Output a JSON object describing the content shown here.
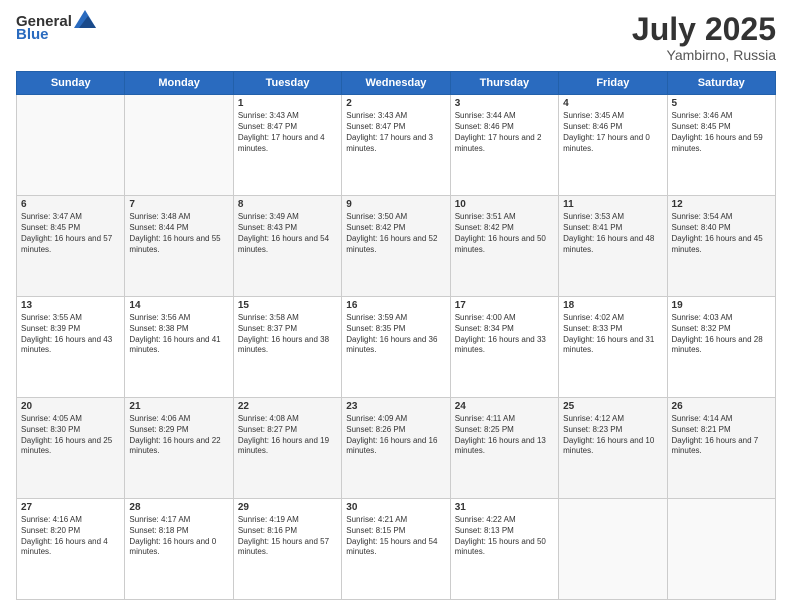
{
  "logo": {
    "text_general": "General",
    "text_blue": "Blue"
  },
  "title": {
    "month_year": "July 2025",
    "location": "Yambirno, Russia"
  },
  "weekdays": [
    "Sunday",
    "Monday",
    "Tuesday",
    "Wednesday",
    "Thursday",
    "Friday",
    "Saturday"
  ],
  "weeks": [
    [
      {
        "day": "",
        "sunrise": "",
        "sunset": "",
        "daylight": ""
      },
      {
        "day": "",
        "sunrise": "",
        "sunset": "",
        "daylight": ""
      },
      {
        "day": "1",
        "sunrise": "Sunrise: 3:43 AM",
        "sunset": "Sunset: 8:47 PM",
        "daylight": "Daylight: 17 hours and 4 minutes."
      },
      {
        "day": "2",
        "sunrise": "Sunrise: 3:43 AM",
        "sunset": "Sunset: 8:47 PM",
        "daylight": "Daylight: 17 hours and 3 minutes."
      },
      {
        "day": "3",
        "sunrise": "Sunrise: 3:44 AM",
        "sunset": "Sunset: 8:46 PM",
        "daylight": "Daylight: 17 hours and 2 minutes."
      },
      {
        "day": "4",
        "sunrise": "Sunrise: 3:45 AM",
        "sunset": "Sunset: 8:46 PM",
        "daylight": "Daylight: 17 hours and 0 minutes."
      },
      {
        "day": "5",
        "sunrise": "Sunrise: 3:46 AM",
        "sunset": "Sunset: 8:45 PM",
        "daylight": "Daylight: 16 hours and 59 minutes."
      }
    ],
    [
      {
        "day": "6",
        "sunrise": "Sunrise: 3:47 AM",
        "sunset": "Sunset: 8:45 PM",
        "daylight": "Daylight: 16 hours and 57 minutes."
      },
      {
        "day": "7",
        "sunrise": "Sunrise: 3:48 AM",
        "sunset": "Sunset: 8:44 PM",
        "daylight": "Daylight: 16 hours and 55 minutes."
      },
      {
        "day": "8",
        "sunrise": "Sunrise: 3:49 AM",
        "sunset": "Sunset: 8:43 PM",
        "daylight": "Daylight: 16 hours and 54 minutes."
      },
      {
        "day": "9",
        "sunrise": "Sunrise: 3:50 AM",
        "sunset": "Sunset: 8:42 PM",
        "daylight": "Daylight: 16 hours and 52 minutes."
      },
      {
        "day": "10",
        "sunrise": "Sunrise: 3:51 AM",
        "sunset": "Sunset: 8:42 PM",
        "daylight": "Daylight: 16 hours and 50 minutes."
      },
      {
        "day": "11",
        "sunrise": "Sunrise: 3:53 AM",
        "sunset": "Sunset: 8:41 PM",
        "daylight": "Daylight: 16 hours and 48 minutes."
      },
      {
        "day": "12",
        "sunrise": "Sunrise: 3:54 AM",
        "sunset": "Sunset: 8:40 PM",
        "daylight": "Daylight: 16 hours and 45 minutes."
      }
    ],
    [
      {
        "day": "13",
        "sunrise": "Sunrise: 3:55 AM",
        "sunset": "Sunset: 8:39 PM",
        "daylight": "Daylight: 16 hours and 43 minutes."
      },
      {
        "day": "14",
        "sunrise": "Sunrise: 3:56 AM",
        "sunset": "Sunset: 8:38 PM",
        "daylight": "Daylight: 16 hours and 41 minutes."
      },
      {
        "day": "15",
        "sunrise": "Sunrise: 3:58 AM",
        "sunset": "Sunset: 8:37 PM",
        "daylight": "Daylight: 16 hours and 38 minutes."
      },
      {
        "day": "16",
        "sunrise": "Sunrise: 3:59 AM",
        "sunset": "Sunset: 8:35 PM",
        "daylight": "Daylight: 16 hours and 36 minutes."
      },
      {
        "day": "17",
        "sunrise": "Sunrise: 4:00 AM",
        "sunset": "Sunset: 8:34 PM",
        "daylight": "Daylight: 16 hours and 33 minutes."
      },
      {
        "day": "18",
        "sunrise": "Sunrise: 4:02 AM",
        "sunset": "Sunset: 8:33 PM",
        "daylight": "Daylight: 16 hours and 31 minutes."
      },
      {
        "day": "19",
        "sunrise": "Sunrise: 4:03 AM",
        "sunset": "Sunset: 8:32 PM",
        "daylight": "Daylight: 16 hours and 28 minutes."
      }
    ],
    [
      {
        "day": "20",
        "sunrise": "Sunrise: 4:05 AM",
        "sunset": "Sunset: 8:30 PM",
        "daylight": "Daylight: 16 hours and 25 minutes."
      },
      {
        "day": "21",
        "sunrise": "Sunrise: 4:06 AM",
        "sunset": "Sunset: 8:29 PM",
        "daylight": "Daylight: 16 hours and 22 minutes."
      },
      {
        "day": "22",
        "sunrise": "Sunrise: 4:08 AM",
        "sunset": "Sunset: 8:27 PM",
        "daylight": "Daylight: 16 hours and 19 minutes."
      },
      {
        "day": "23",
        "sunrise": "Sunrise: 4:09 AM",
        "sunset": "Sunset: 8:26 PM",
        "daylight": "Daylight: 16 hours and 16 minutes."
      },
      {
        "day": "24",
        "sunrise": "Sunrise: 4:11 AM",
        "sunset": "Sunset: 8:25 PM",
        "daylight": "Daylight: 16 hours and 13 minutes."
      },
      {
        "day": "25",
        "sunrise": "Sunrise: 4:12 AM",
        "sunset": "Sunset: 8:23 PM",
        "daylight": "Daylight: 16 hours and 10 minutes."
      },
      {
        "day": "26",
        "sunrise": "Sunrise: 4:14 AM",
        "sunset": "Sunset: 8:21 PM",
        "daylight": "Daylight: 16 hours and 7 minutes."
      }
    ],
    [
      {
        "day": "27",
        "sunrise": "Sunrise: 4:16 AM",
        "sunset": "Sunset: 8:20 PM",
        "daylight": "Daylight: 16 hours and 4 minutes."
      },
      {
        "day": "28",
        "sunrise": "Sunrise: 4:17 AM",
        "sunset": "Sunset: 8:18 PM",
        "daylight": "Daylight: 16 hours and 0 minutes."
      },
      {
        "day": "29",
        "sunrise": "Sunrise: 4:19 AM",
        "sunset": "Sunset: 8:16 PM",
        "daylight": "Daylight: 15 hours and 57 minutes."
      },
      {
        "day": "30",
        "sunrise": "Sunrise: 4:21 AM",
        "sunset": "Sunset: 8:15 PM",
        "daylight": "Daylight: 15 hours and 54 minutes."
      },
      {
        "day": "31",
        "sunrise": "Sunrise: 4:22 AM",
        "sunset": "Sunset: 8:13 PM",
        "daylight": "Daylight: 15 hours and 50 minutes."
      },
      {
        "day": "",
        "sunrise": "",
        "sunset": "",
        "daylight": ""
      },
      {
        "day": "",
        "sunrise": "",
        "sunset": "",
        "daylight": ""
      }
    ]
  ]
}
